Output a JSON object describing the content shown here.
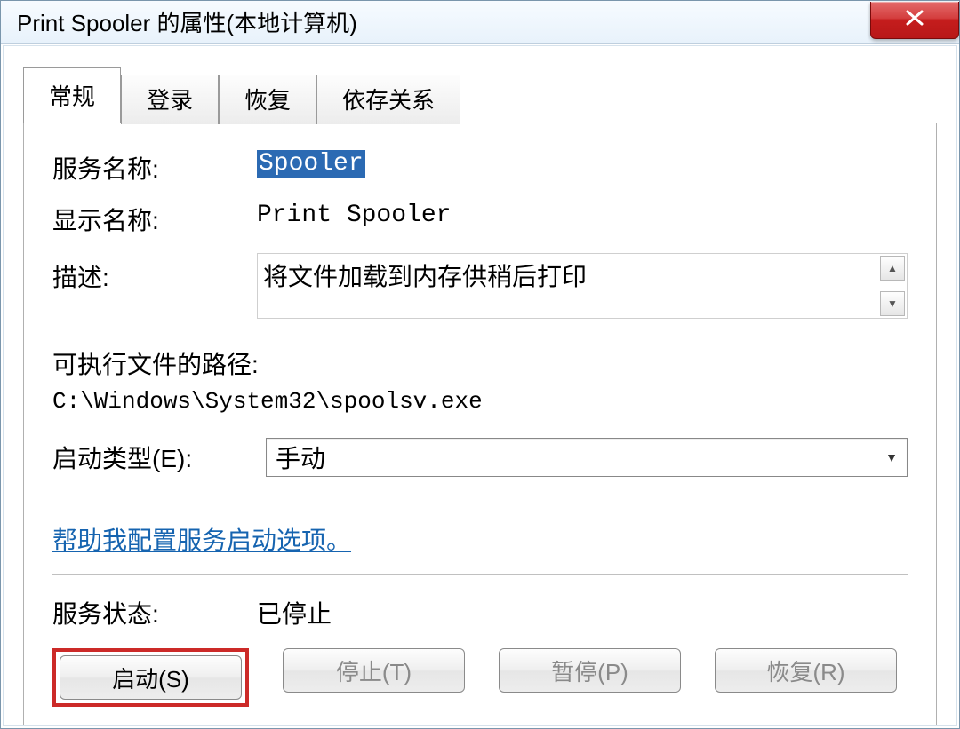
{
  "window": {
    "title": "Print Spooler 的属性(本地计算机)"
  },
  "tabs": {
    "general": "常规",
    "logon": "登录",
    "recovery": "恢复",
    "dependencies": "依存关系"
  },
  "general": {
    "service_name_label": "服务名称:",
    "service_name_value": "Spooler",
    "display_name_label": "显示名称:",
    "display_name_value": "Print Spooler",
    "description_label": "描述:",
    "description_value": "将文件加载到内存供稍后打印",
    "exe_path_label": "可执行文件的路径:",
    "exe_path_value": "C:\\Windows\\System32\\spoolsv.exe",
    "startup_type_label": "启动类型(E):",
    "startup_type_value": "手动",
    "help_link": "帮助我配置服务启动选项。",
    "service_status_label": "服务状态:",
    "service_status_value": "已停止"
  },
  "buttons": {
    "start": "启动(S)",
    "stop": "停止(T)",
    "pause": "暂停(P)",
    "resume": "恢复(R)"
  }
}
